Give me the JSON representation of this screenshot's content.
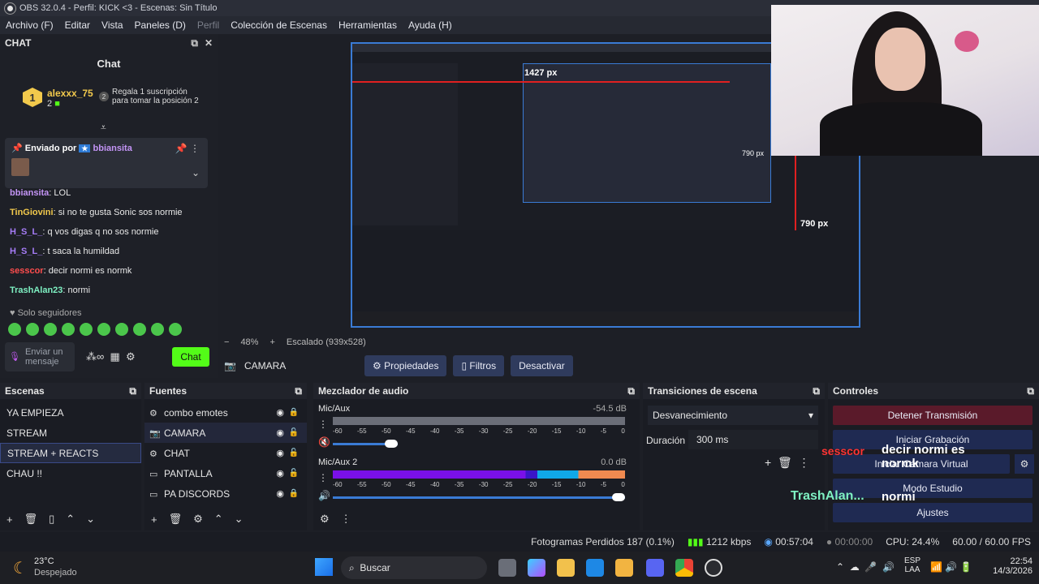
{
  "window": {
    "title": "OBS 32.0.4 - Perfil: KICK <3 - Escenas: Sin Título"
  },
  "menu": [
    "Archivo (F)",
    "Editar",
    "Vista",
    "Paneles (D)",
    "Perfil",
    "Colección de Escenas",
    "Herramientas",
    "Ayuda (H)"
  ],
  "chat": {
    "dock_title": "CHAT",
    "title": "Chat",
    "leader": {
      "rank": "1",
      "name": "alexxx_75",
      "count": "2"
    },
    "leader2": {
      "rank": "2",
      "text": "Regala 1 suscripción para tomar la posición 2"
    },
    "pinned": {
      "prefix": "Enviado por",
      "user": "bbiansita"
    },
    "messages": [
      {
        "user": "bbiansita",
        "color": "#c394f5",
        "text": ": LOL"
      },
      {
        "user": "TinGiovini",
        "color": "#f2c94c",
        "text": ": si no te gusta Sonic sos normie"
      },
      {
        "user": "H_S_L_",
        "color": "#a67cf7",
        "text": ": q vos digas q no sos normie"
      },
      {
        "user": "H_S_L_",
        "color": "#a67cf7",
        "text": ": t saca la humildad"
      },
      {
        "user": "sesscor",
        "color": "#ff4d4d",
        "text": ": decir normi es normk"
      },
      {
        "user": "TrashAlan23",
        "color": "#7ef0c2",
        "text": ": normi"
      }
    ],
    "followers_only": "Solo seguidores",
    "input_placeholder": "Enviar un mensaje",
    "send_label": "Chat"
  },
  "preview": {
    "zoom": "48%",
    "scale": "Escalado (939x528)",
    "dim1": "1427 px",
    "dim2": "790 px",
    "dim3": "790 px"
  },
  "source_bar": {
    "source": "CAMARA",
    "props": "Propiedades",
    "filters": "Filtros",
    "deactivate": "Desactivar"
  },
  "scenes": {
    "title": "Escenas",
    "items": [
      "YA EMPIEZA",
      "STREAM",
      "STREAM + REACTS",
      "CHAU !!"
    ],
    "selected": 2
  },
  "sources": {
    "title": "Fuentes",
    "items": [
      {
        "name": "combo emotes",
        "icon": "⚙"
      },
      {
        "name": "CAMARA",
        "icon": "📷"
      },
      {
        "name": "CHAT",
        "icon": "⚙"
      },
      {
        "name": "PANTALLA",
        "icon": "▭"
      },
      {
        "name": "PA DISCORDS",
        "icon": "▭"
      }
    ]
  },
  "mixer": {
    "title": "Mezclador de audio",
    "tracks": [
      {
        "name": "Mic/Aux",
        "db": "-54.5 dB"
      },
      {
        "name": "Mic/Aux 2",
        "db": "0.0 dB"
      }
    ],
    "ticks": [
      "-60",
      "-55",
      "-50",
      "-45",
      "-40",
      "-35",
      "-30",
      "-25",
      "-20",
      "-15",
      "-10",
      "-5",
      "0"
    ]
  },
  "transitions": {
    "title": "Transiciones de escena",
    "selected": "Desvanecimiento",
    "duration_label": "Duración",
    "duration": "300 ms"
  },
  "controls": {
    "title": "Controles",
    "buttons": [
      "Detener Transmisión",
      "Iniciar Grabación",
      "Iniciar Cámara Virtual",
      "Modo Estudio",
      "Ajustes"
    ]
  },
  "overlay": {
    "user1": "sesscor",
    "msg1": "decir normi es normk",
    "user2": "TrashAlan...",
    "msg2": "normi"
  },
  "status": {
    "dropped": "Fotogramas Perdidos 187 (0.1%)",
    "kbps": "1212 kbps",
    "live": "00:57:04",
    "rec": "00:00:00",
    "cpu": "CPU: 24.4%",
    "fps": "60.00 / 60.00 FPS"
  },
  "taskbar": {
    "temp": "23°C",
    "weather": "Despejado",
    "search": "Buscar",
    "lang1": "ESP",
    "lang2": "LAA",
    "time": "22:54",
    "date": "14/3/2026"
  },
  "colors": {
    "accent": "#3a7bd5",
    "kick_green": "#53fc18",
    "stop_red": "#5a1a2a",
    "control_blue": "#1f2a52"
  }
}
